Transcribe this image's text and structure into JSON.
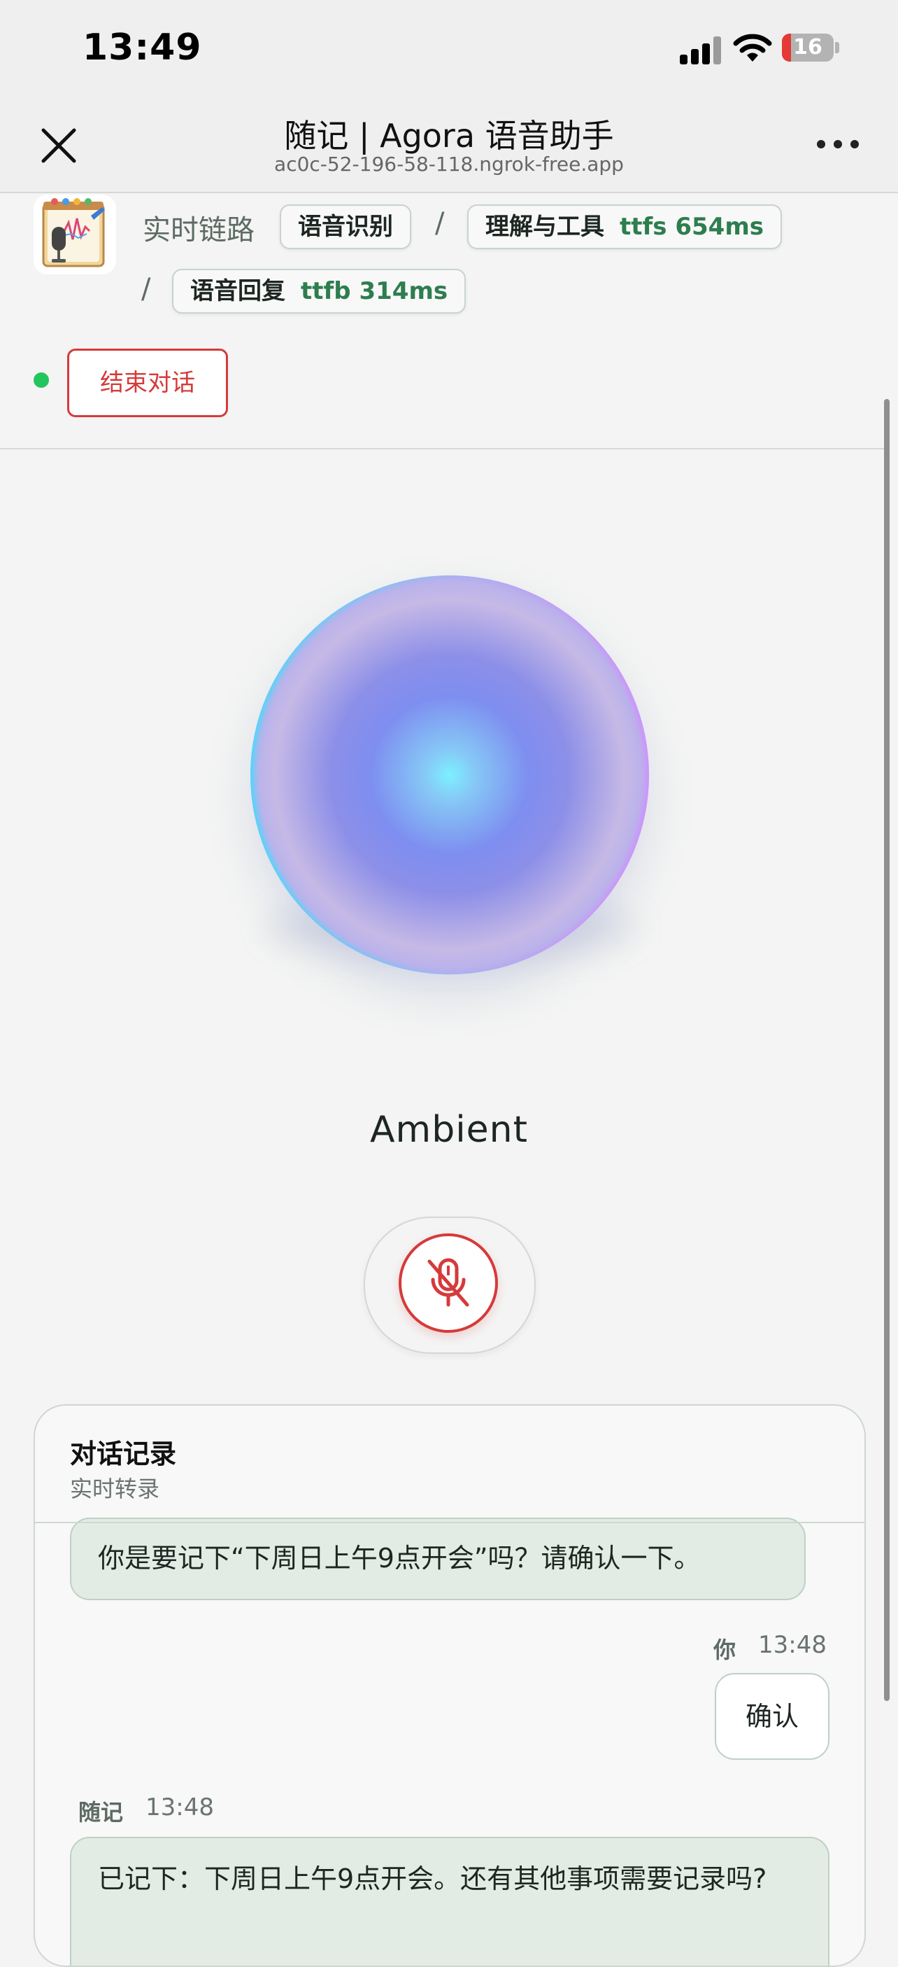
{
  "status_bar": {
    "time": "13:49",
    "battery": "16"
  },
  "header": {
    "title": "随记 | Agora 语音助手",
    "url": "ac0c-52-196-58-118.ngrok-free.app"
  },
  "pipeline": {
    "label": "实时链路",
    "separator": "/",
    "stages": [
      {
        "name": "语音识别",
        "metric": ""
      },
      {
        "name": "理解与工具",
        "metric": "ttfs 654ms"
      },
      {
        "name": "语音回复",
        "metric": "ttfb 314ms"
      }
    ]
  },
  "session": {
    "end_label": "结束对话"
  },
  "orb": {
    "state": "Ambient"
  },
  "mic": {
    "state": "muted"
  },
  "transcript": {
    "title": "对话记录",
    "subtitle": "实时转录",
    "messages": [
      {
        "role": "agent",
        "speaker": "",
        "time": "",
        "text": "你是要记下“下周日上午9点开会”吗？请确认一下。"
      },
      {
        "role": "user",
        "speaker": "你",
        "time": "13:48",
        "text": "确认"
      },
      {
        "role": "agent",
        "speaker": "随记",
        "time": "13:48",
        "text": "已记下：下周日上午9点开会。还有其他事项需要记录吗?"
      }
    ]
  },
  "colors": {
    "accent_red": "#d63a3a",
    "live_green": "#23c55e",
    "metric_green": "#2e7d4f",
    "agent_bubble": "#e3ebe5"
  }
}
